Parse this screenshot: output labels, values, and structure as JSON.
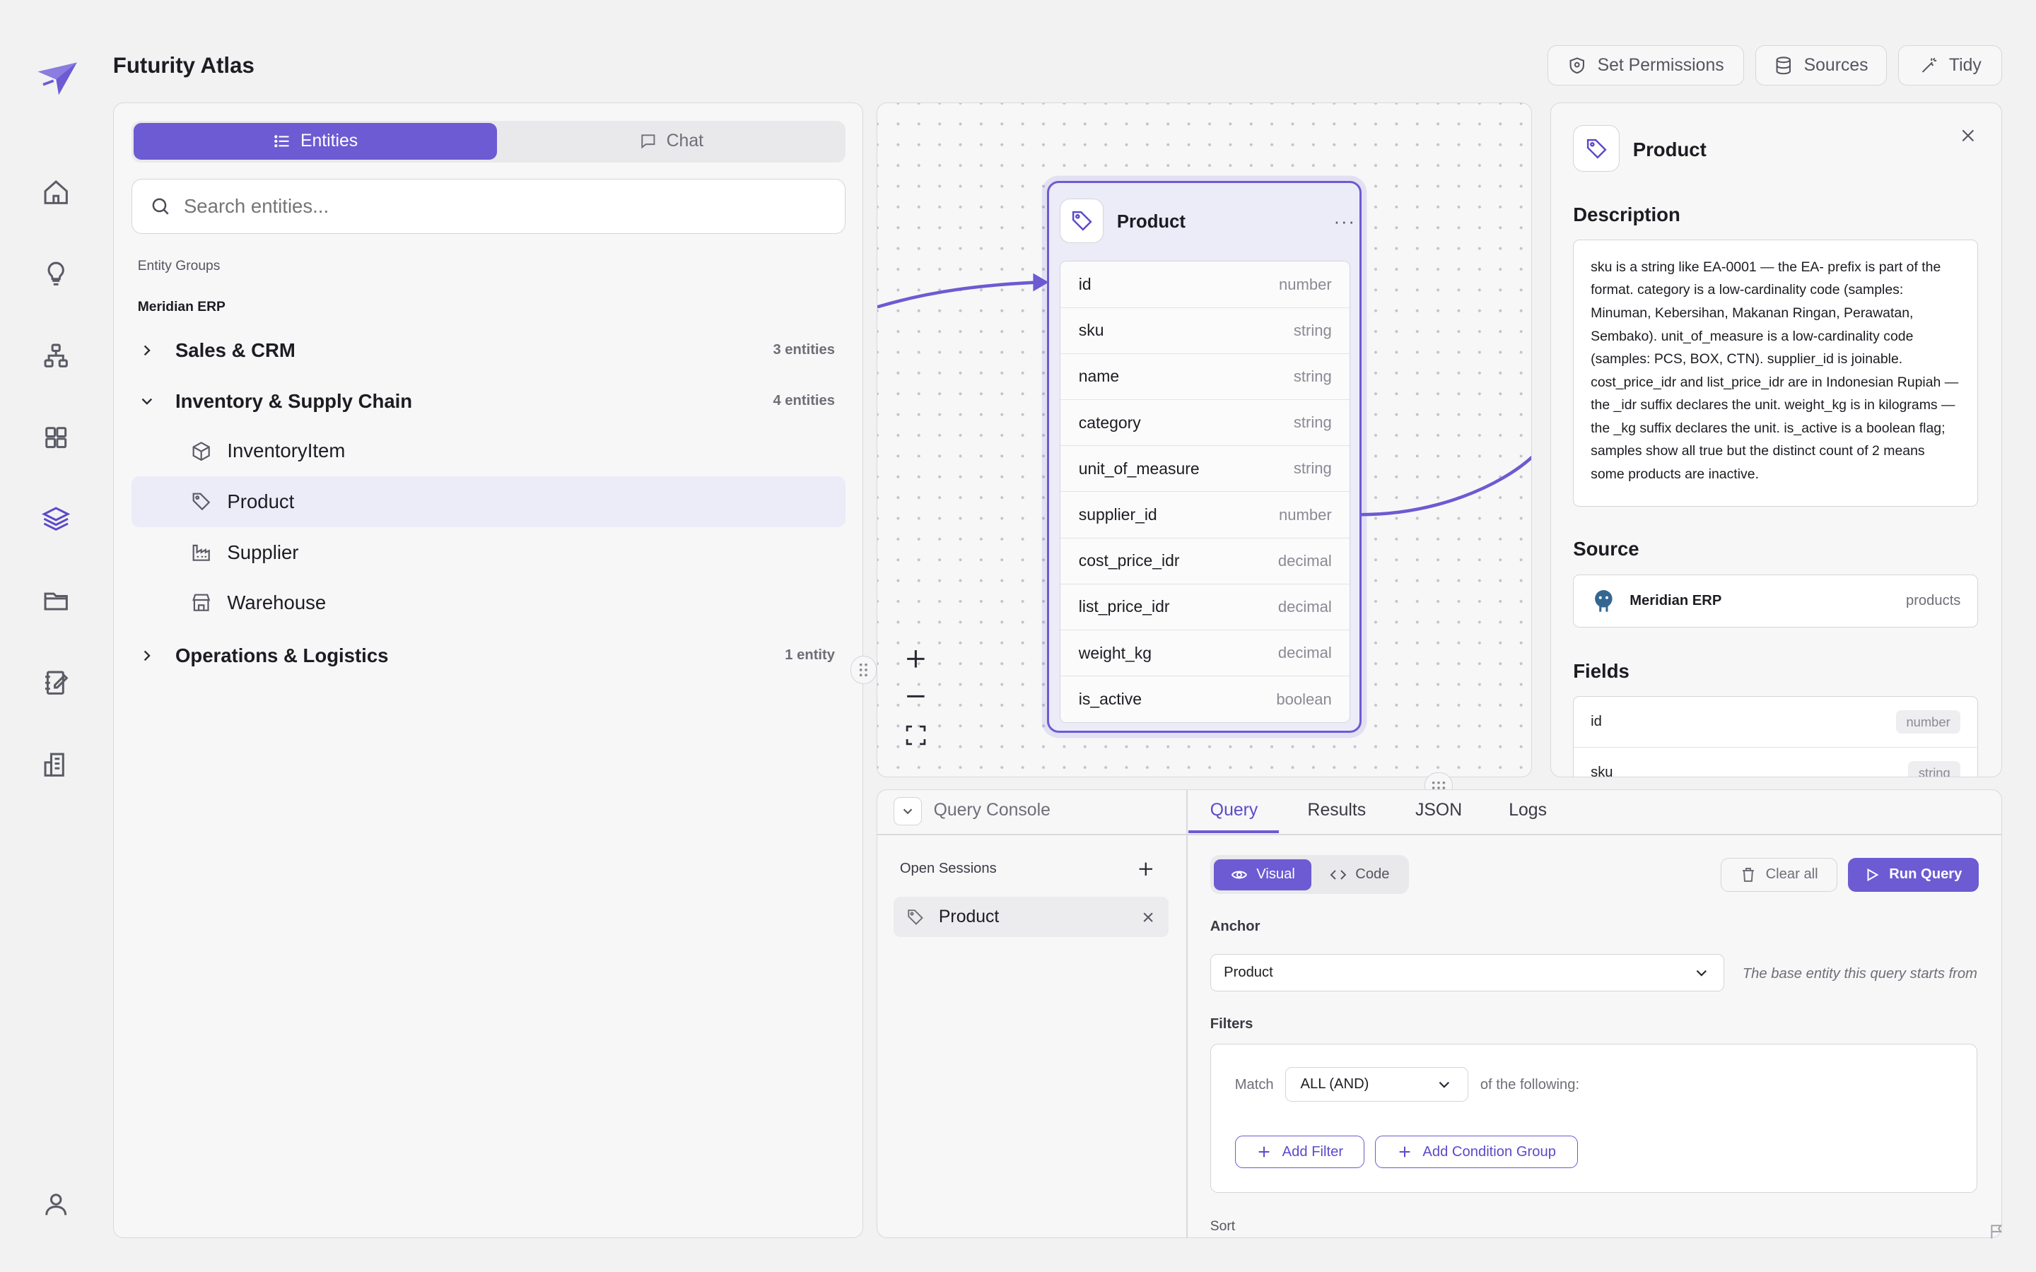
{
  "app": {
    "title": "Futurity Atlas"
  },
  "header": {
    "permissions_label": "Set Permissions",
    "sources_label": "Sources",
    "tidy_label": "Tidy"
  },
  "rail": {
    "icons": [
      "home-icon",
      "lightbulb-icon",
      "hierarchy-icon",
      "grid-icon",
      "layers-icon",
      "folder-icon",
      "notebook-icon",
      "building-icon",
      "user-icon"
    ]
  },
  "left_panel": {
    "tabs": {
      "entities": "Entities",
      "chat": "Chat"
    },
    "search_placeholder": "Search entities...",
    "section_label": "Entity Groups",
    "source_name": "Meridian ERP",
    "groups": [
      {
        "name": "Sales & CRM",
        "count": "3 entities"
      },
      {
        "name": "Inventory & Supply Chain",
        "count": "4 entities"
      },
      {
        "name": "Operations & Logistics",
        "count": "1 entity"
      }
    ],
    "items": [
      "InventoryItem",
      "Product",
      "Supplier",
      "Warehouse"
    ]
  },
  "canvas": {
    "node": {
      "title": "Product",
      "fields": [
        {
          "name": "id",
          "type": "number"
        },
        {
          "name": "sku",
          "type": "string"
        },
        {
          "name": "name",
          "type": "string"
        },
        {
          "name": "category",
          "type": "string"
        },
        {
          "name": "unit_of_measure",
          "type": "string"
        },
        {
          "name": "supplier_id",
          "type": "number"
        },
        {
          "name": "cost_price_idr",
          "type": "decimal"
        },
        {
          "name": "list_price_idr",
          "type": "decimal"
        },
        {
          "name": "weight_kg",
          "type": "decimal"
        },
        {
          "name": "is_active",
          "type": "boolean"
        }
      ]
    }
  },
  "details": {
    "title": "Product",
    "description_heading": "Description",
    "description": "sku is a string like EA-0001 — the EA- prefix is part of the format. category is a low-cardinality code (samples: Minuman, Kebersihan, Makanan Ringan, Perawatan, Sembako). unit_of_measure is a low-cardinality code (samples: PCS, BOX, CTN). supplier_id is joinable. cost_price_idr and list_price_idr are in Indonesian Rupiah — the _idr suffix declares the unit. weight_kg is in kilograms — the _kg suffix declares the unit. is_active is a boolean flag; samples show all true but the distinct count of 2 means some products are inactive.",
    "source_heading": "Source",
    "source_name": "Meridian ERP",
    "source_table": "products",
    "fields_heading": "Fields",
    "fields": [
      {
        "name": "id",
        "type": "number"
      },
      {
        "name": "sku",
        "type": "string"
      }
    ]
  },
  "console": {
    "title": "Query Console",
    "sessions_label": "Open Sessions",
    "session": "Product",
    "tabs": [
      "Query",
      "Results",
      "JSON",
      "Logs"
    ],
    "mode_visual": "Visual",
    "mode_code": "Code",
    "clear_label": "Clear all",
    "run_label": "Run Query",
    "anchor_label": "Anchor",
    "anchor_value": "Product",
    "anchor_hint": "The base entity this query starts from",
    "filters_label": "Filters",
    "match_label": "Match",
    "match_value": "ALL (AND)",
    "match_suffix": "of the following:",
    "add_filter": "Add Filter",
    "add_group": "Add Condition Group",
    "sort_label": "Sort"
  },
  "colors": {
    "accent": "#6c5bd2",
    "accent_light": "#ecebf8"
  }
}
